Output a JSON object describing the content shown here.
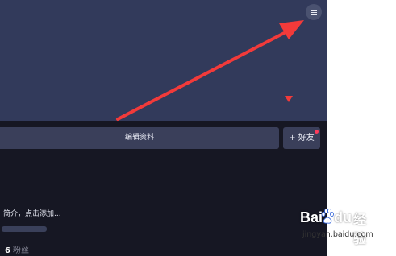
{
  "header": {
    "menu_icon": "hamburger-menu-icon"
  },
  "actions": {
    "edit_profile_label": "编辑资料",
    "add_friend_label": "+ 好友"
  },
  "profile": {
    "bio_placeholder": "简介，点击添加...",
    "followers_count": "6",
    "followers_label": "粉丝"
  },
  "annotation": {
    "arrow_color": "#f23a3a",
    "marker_color": "#f23a3a"
  },
  "watermark": {
    "brand_left": "Bai",
    "brand_right": "du",
    "product": "经验",
    "url": "jingyan.baidu.com"
  },
  "colors": {
    "cover_background": "#323a5b",
    "page_background": "#161723",
    "button_background": "#3a3f5a",
    "notification_dot": "#ff3b5c"
  }
}
